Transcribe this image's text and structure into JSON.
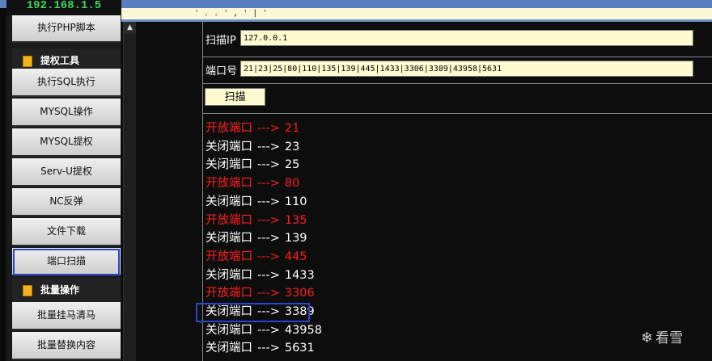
{
  "top_bar": {
    "ip": "192.168.1.5",
    "cutoff_text": "'  .    .  '  ,   '  |  '"
  },
  "sidebar": {
    "items": [
      {
        "type": "item",
        "label": "执行PHP脚本"
      },
      {
        "type": "header",
        "label": "提权工具",
        "icon": "folder-arrow-icon"
      },
      {
        "type": "item",
        "label": "执行SQL执行"
      },
      {
        "type": "item",
        "label": "MYSQL操作"
      },
      {
        "type": "item",
        "label": "MYSQL提权"
      },
      {
        "type": "item",
        "label": "Serv-U提权"
      },
      {
        "type": "item",
        "label": "NC反弹"
      },
      {
        "type": "item",
        "label": "文件下载"
      },
      {
        "type": "item",
        "label": "端口扫描",
        "highlighted": true
      },
      {
        "type": "header",
        "label": "批量操作",
        "icon": "folder-arrow-icon"
      },
      {
        "type": "item",
        "label": "批量挂马清马"
      },
      {
        "type": "item",
        "label": "批量替换内容"
      }
    ]
  },
  "scanner": {
    "ip_label": "扫描IP",
    "ip_value": "127.0.0.1",
    "port_label": "端口号",
    "port_value": "21|23|25|80|110|135|139|445|1433|3306|3389|43958|5631",
    "scan_button": "扫描"
  },
  "results": [
    {
      "status": "开放端口",
      "arrow": "--->",
      "port": "21",
      "open": true
    },
    {
      "status": "关闭端口",
      "arrow": "--->",
      "port": "23",
      "open": false
    },
    {
      "status": "关闭端口",
      "arrow": "--->",
      "port": "25",
      "open": false
    },
    {
      "status": "开放端口",
      "arrow": "--->",
      "port": "80",
      "open": true
    },
    {
      "status": "关闭端口",
      "arrow": "--->",
      "port": "110",
      "open": false
    },
    {
      "status": "开放端口",
      "arrow": "--->",
      "port": "135",
      "open": true
    },
    {
      "status": "关闭端口",
      "arrow": "--->",
      "port": "139",
      "open": false
    },
    {
      "status": "开放端口",
      "arrow": "--->",
      "port": "445",
      "open": true
    },
    {
      "status": "关闭端口",
      "arrow": "--->",
      "port": "1433",
      "open": false
    },
    {
      "status": "开放端口",
      "arrow": "--->",
      "port": "3306",
      "open": true
    },
    {
      "status": "关闭端口",
      "arrow": "--->",
      "port": "3389",
      "open": false,
      "highlighted": true
    },
    {
      "status": "关闭端口",
      "arrow": "--->",
      "port": "43958",
      "open": false
    },
    {
      "status": "关闭端口",
      "arrow": "--->",
      "port": "5631",
      "open": false
    }
  ],
  "watermark": {
    "flake": "❄",
    "text": "看雪"
  },
  "colors": {
    "open": "#ff1e1e",
    "closed": "#ffffff",
    "highlight": "#2b45c9",
    "field_bg": "#fffbd0",
    "ip_green": "#3fd35a"
  }
}
